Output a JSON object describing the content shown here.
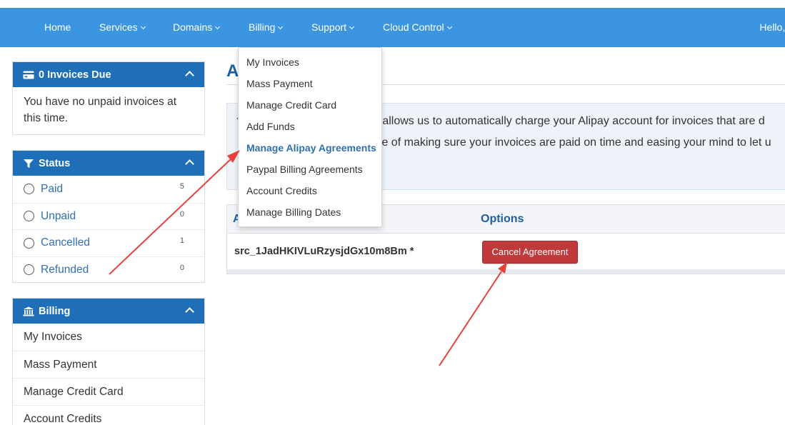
{
  "nav": {
    "home": "Home",
    "services": "Services",
    "domains": "Domains",
    "billing": "Billing",
    "support": "Support",
    "cloud_control": "Cloud Control",
    "greeting": "Hello, I"
  },
  "sidebar": {
    "invoices_panel": {
      "title": "0 Invoices Due",
      "message": "You have no unpaid invoices at this time."
    },
    "status_panel": {
      "title": "Status",
      "items": [
        {
          "label": "Paid",
          "count": "5"
        },
        {
          "label": "Unpaid",
          "count": "0"
        },
        {
          "label": "Cancelled",
          "count": "1"
        },
        {
          "label": "Refunded",
          "count": "0"
        }
      ]
    },
    "billing_panel": {
      "title": "Billing",
      "items": [
        "My Invoices",
        "Mass Payment",
        "Manage Credit Card",
        "Account Credits"
      ]
    }
  },
  "main": {
    "title_fragment": "A",
    "info_mark": "Y",
    "info_line1": "t ID allows us to automatically charge your Alipay account for invoices that are d",
    "info_line2": "assle of making sure your invoices are paid on time and easing your mind to let u",
    "table": {
      "col1_fragment": "A",
      "col2": "Options",
      "agreement_id": "src_1JadHKIVLuRzysjdGx10m8Bm *",
      "cancel_label": "Cancel Agreement"
    }
  },
  "billing_dropdown": {
    "items": [
      {
        "label": "My Invoices",
        "active": false
      },
      {
        "label": "Mass Payment",
        "active": false
      },
      {
        "label": "Manage Credit Card",
        "active": false
      },
      {
        "label": "Add Funds",
        "active": false
      },
      {
        "label": "Manage Alipay Agreements",
        "active": true
      },
      {
        "label": "Paypal Billing Agreements",
        "active": false
      },
      {
        "label": "Account Credits",
        "active": false
      },
      {
        "label": "Manage Billing Dates",
        "active": false
      }
    ]
  },
  "colors": {
    "nav_bg": "#3b95e0",
    "panel_header": "#1e6fb8",
    "link": "#2f6fb4",
    "danger": "#c0393b",
    "annotation": "#e8413c"
  }
}
